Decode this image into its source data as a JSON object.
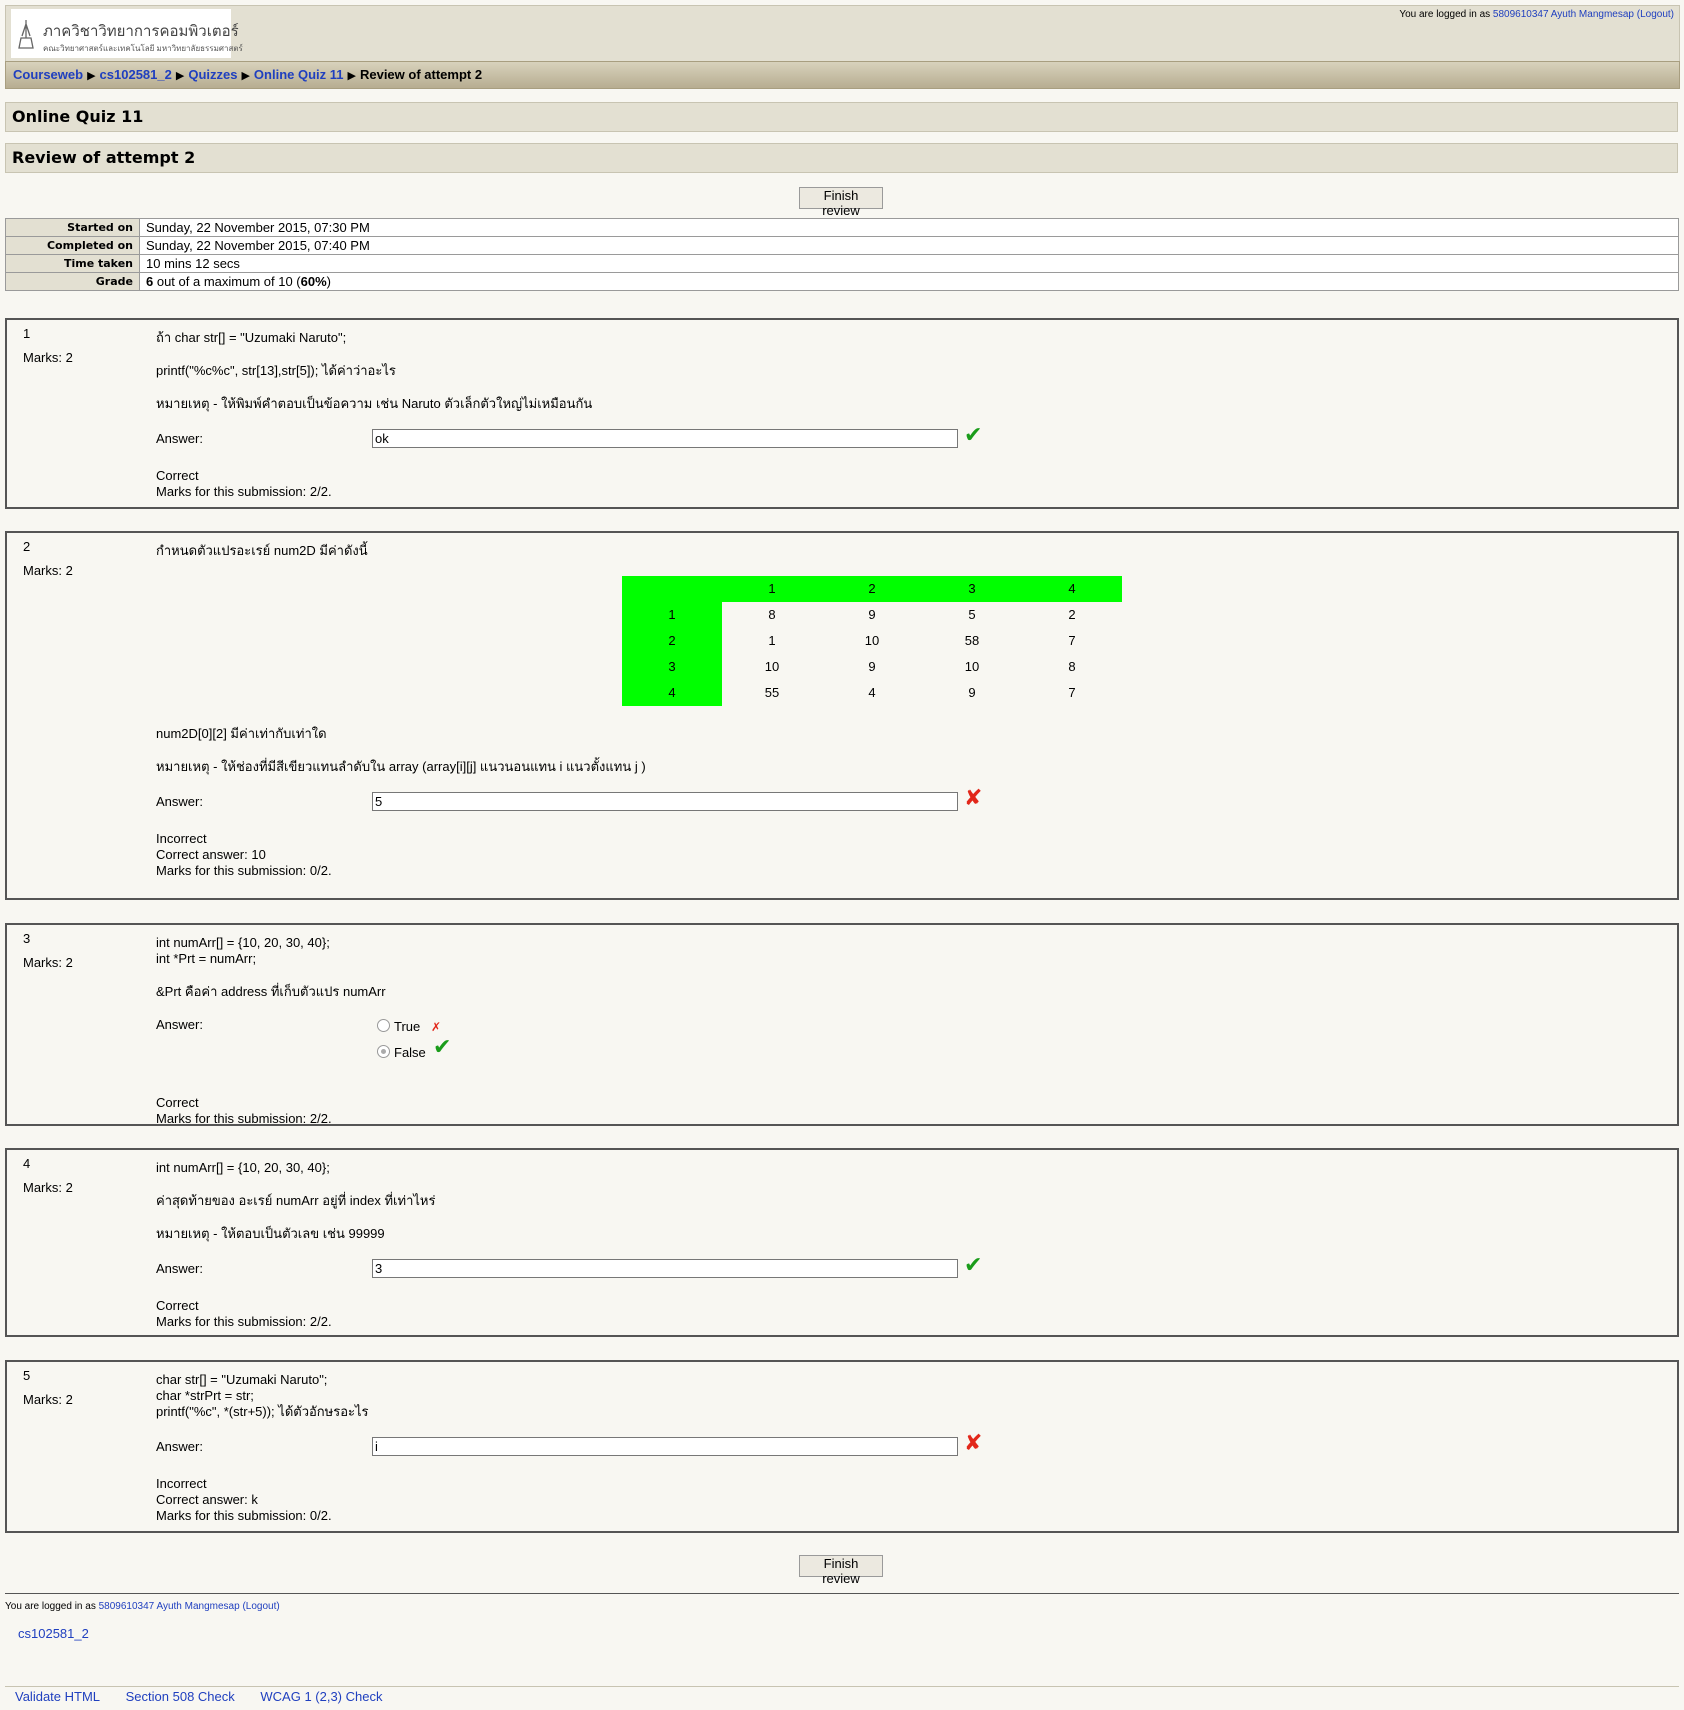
{
  "header": {
    "logo_line1": "ภาควิชาวิทยาการคอมพิวเตอร์",
    "logo_line2": "คณะวิทยาศาสตร์และเทคโนโลยี มหาวิทยาลัยธรรมศาสตร์",
    "login_prefix": "You are logged in as",
    "user_name": "5809610347 Ayuth Mangmesap",
    "logout": "(Logout)"
  },
  "breadcrumb": {
    "items": [
      "Courseweb",
      "cs102581_2",
      "Quizzes",
      "Online Quiz 11"
    ],
    "current": "Review of attempt 2",
    "separator": "▶"
  },
  "page": {
    "quiz_title": "Online Quiz 11",
    "review_title": "Review of attempt 2",
    "finish_button": "Finish review"
  },
  "summary": {
    "started_label": "Started on",
    "started_value": "Sunday, 22 November 2015, 07:30 PM",
    "completed_label": "Completed on",
    "completed_value": "Sunday, 22 November 2015, 07:40 PM",
    "time_label": "Time taken",
    "time_value": "10 mins 12 secs",
    "grade_label": "Grade",
    "grade_score": "6",
    "grade_mid": " out of a maximum of 10 (",
    "grade_pct": "60%",
    "grade_end": ")"
  },
  "common": {
    "answer_label": "Answer:"
  },
  "q1": {
    "number": "1",
    "marks": "Marks: 2",
    "text1": "ถ้า char str[] = \"Uzumaki Naruto\";",
    "text2": "printf(\"%c%c\", str[13],str[5]); ได้ค่าว่าอะไร",
    "text3": "หมายเหตุ - ให้พิมพ์คำตอบเป็นข้อความ เช่น Naruto ตัวเล็กตัวใหญ่ไม่เหมือนกัน",
    "answer": "ok",
    "result": "Correct",
    "marks_sub": "Marks for this submission: 2/2."
  },
  "q2": {
    "number": "2",
    "marks": "Marks: 2",
    "text1": "กำหนดตัวแปรอะเรย์ num2D มีค่าดังนี้",
    "grid_header": [
      "",
      "1",
      "2",
      "3",
      "4"
    ],
    "grid_rows": [
      [
        "1",
        "8",
        "9",
        "5",
        "2"
      ],
      [
        "2",
        "1",
        "10",
        "58",
        "7"
      ],
      [
        "3",
        "10",
        "9",
        "10",
        "8"
      ],
      [
        "4",
        "55",
        "4",
        "9",
        "7"
      ]
    ],
    "text2": "num2D[0][2] มีค่าเท่ากับเท่าใด",
    "text3": "หมายเหตุ - ให้ช่องที่มีสีเขียวแทนลำดับใน array (array[i][j] แนวนอนแทน i แนวตั้งแทน j )",
    "answer": "5",
    "result": "Incorrect",
    "correct_answer": "Correct answer: 10",
    "marks_sub": "Marks for this submission: 0/2."
  },
  "q3": {
    "number": "3",
    "marks": "Marks: 2",
    "code1": "int numArr[] = {10, 20, 30, 40};",
    "code2": "int *Prt = numArr;",
    "text1": "&Prt คือค่า address ที่เก็บตัวแปร numArr",
    "option_true": "True",
    "option_false": "False",
    "selected": "False",
    "result": "Correct",
    "marks_sub": "Marks for this submission: 2/2."
  },
  "q4": {
    "number": "4",
    "marks": "Marks: 2",
    "code1": "int numArr[] = {10, 20, 30, 40};",
    "text1": "ค่าสุดท้ายของ อะเรย์ numArr อยู่ที่ index ที่เท่าไหร่",
    "text2": "หมายเหตุ - ให้ตอบเป็นตัวเลข เช่น 99999",
    "answer": "3",
    "result": "Correct",
    "marks_sub": "Marks for this submission: 2/2."
  },
  "q5": {
    "number": "5",
    "marks": "Marks: 2",
    "code1": "char str[] = \"Uzumaki Naruto\";",
    "code2": "char *strPrt = str;",
    "code3": "printf(\"%c\", *(str+5)); ได้ตัวอักษรอะไร",
    "answer": "i",
    "result": "Incorrect",
    "correct_answer": "Correct answer: k",
    "marks_sub": "Marks for this submission: 0/2."
  },
  "footer": {
    "login_prefix": "You are logged in as",
    "user_name": "5809610347 Ayuth Mangmesap",
    "logout": "(Logout)",
    "course_link": "cs102581_2",
    "validators": [
      "Validate HTML",
      "Section 508 Check",
      "WCAG 1 (2,3) Check"
    ]
  },
  "icons": {
    "tick": "✔",
    "cross": "✘",
    "small_cross": "✗"
  },
  "colors": {
    "link": "#1f3fbf",
    "tick": "#1a9c1a",
    "cross": "#e2271a",
    "grid_green": "#00ff00"
  }
}
